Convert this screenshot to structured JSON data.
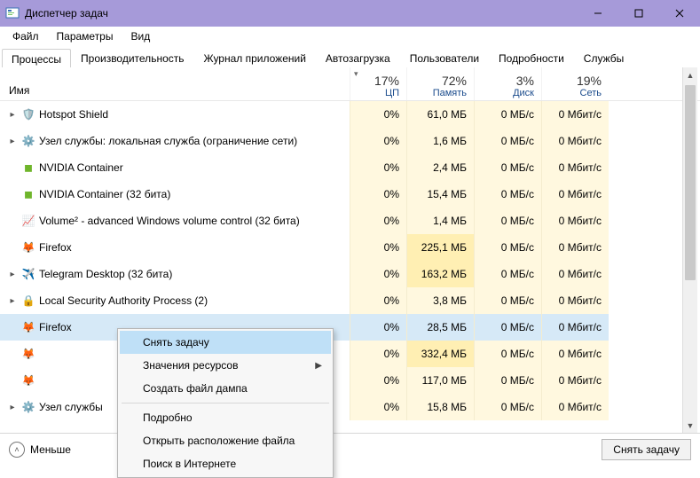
{
  "title": "Диспетчер задач",
  "window_controls": {
    "min": "—",
    "max": "▢",
    "close": "✕"
  },
  "menu": [
    "Файл",
    "Параметры",
    "Вид"
  ],
  "tabs": [
    "Процессы",
    "Производительность",
    "Журнал приложений",
    "Автозагрузка",
    "Пользователи",
    "Подробности",
    "Службы"
  ],
  "active_tab": 0,
  "columns": {
    "name": "Имя",
    "cpu": {
      "pct": "17%",
      "label": "ЦП"
    },
    "mem": {
      "pct": "72%",
      "label": "Память"
    },
    "disk": {
      "pct": "3%",
      "label": "Диск"
    },
    "net": {
      "pct": "19%",
      "label": "Сеть"
    }
  },
  "rows": [
    {
      "icon": "shield-blue",
      "name": "Hotspot Shield",
      "cpu": "0%",
      "mem": "61,0 МБ",
      "disk": "0 МБ/с",
      "net": "0 Мбит/с",
      "exp": true
    },
    {
      "icon": "gear",
      "name": "Узел службы: локальная служба (ограничение сети)",
      "cpu": "0%",
      "mem": "1,6 МБ",
      "disk": "0 МБ/с",
      "net": "0 Мбит/с",
      "exp": true
    },
    {
      "icon": "nvidia",
      "name": "NVIDIA Container",
      "cpu": "0%",
      "mem": "2,4 МБ",
      "disk": "0 МБ/с",
      "net": "0 Мбит/с",
      "exp": false
    },
    {
      "icon": "nvidia",
      "name": "NVIDIA Container (32 бита)",
      "cpu": "0%",
      "mem": "15,4 МБ",
      "disk": "0 МБ/с",
      "net": "0 Мбит/с",
      "exp": false
    },
    {
      "icon": "volume",
      "name": "Volume² - advanced Windows volume control (32 бита)",
      "cpu": "0%",
      "mem": "1,4 МБ",
      "disk": "0 МБ/с",
      "net": "0 Мбит/с",
      "exp": false
    },
    {
      "icon": "firefox",
      "name": "Firefox",
      "cpu": "0%",
      "mem": "225,1 МБ",
      "disk": "0 МБ/с",
      "net": "0 Мбит/с",
      "exp": false
    },
    {
      "icon": "telegram",
      "name": "Telegram Desktop (32 бита)",
      "cpu": "0%",
      "mem": "163,2 МБ",
      "disk": "0 МБ/с",
      "net": "0 Мбит/с",
      "exp": true
    },
    {
      "icon": "lock",
      "name": "Local Security Authority Process (2)",
      "cpu": "0%",
      "mem": "3,8 МБ",
      "disk": "0 МБ/с",
      "net": "0 Мбит/с",
      "exp": true
    },
    {
      "icon": "firefox",
      "name": "Firefox",
      "cpu": "0%",
      "mem": "28,5 МБ",
      "disk": "0 МБ/с",
      "net": "0 Мбит/с",
      "exp": false,
      "selected": true
    },
    {
      "icon": "firefox",
      "name": "",
      "cpu": "0%",
      "mem": "332,4 МБ",
      "disk": "0 МБ/с",
      "net": "0 Мбит/с",
      "exp": false
    },
    {
      "icon": "firefox",
      "name": "",
      "cpu": "0%",
      "mem": "117,0 МБ",
      "disk": "0 МБ/с",
      "net": "0 Мбит/с",
      "exp": false
    },
    {
      "icon": "gear",
      "name": "Узел службы",
      "cpu": "0%",
      "mem": "15,8 МБ",
      "disk": "0 МБ/с",
      "net": "0 Мбит/с",
      "exp": true
    }
  ],
  "context_menu": {
    "items": [
      {
        "label": "Снять задачу",
        "highlight": true
      },
      {
        "label": "Значения ресурсов",
        "submenu": true
      },
      {
        "label": "Создать файл дампа"
      },
      {
        "sep": true
      },
      {
        "label": "Подробно"
      },
      {
        "label": "Открыть расположение файла"
      },
      {
        "label": "Поиск в Интернете"
      }
    ]
  },
  "bottom": {
    "less": "Меньше",
    "endtask": "Снять задачу"
  },
  "icons": {
    "shield-blue": "🛡️",
    "gear": "⚙️",
    "nvidia": "◼︎",
    "volume": "📈",
    "firefox": "🦊",
    "telegram": "✈️",
    "lock": "🔒"
  },
  "mem_shade": {
    "default": "warm1",
    "heavy": "warm2",
    "heaviest": "warm3"
  }
}
